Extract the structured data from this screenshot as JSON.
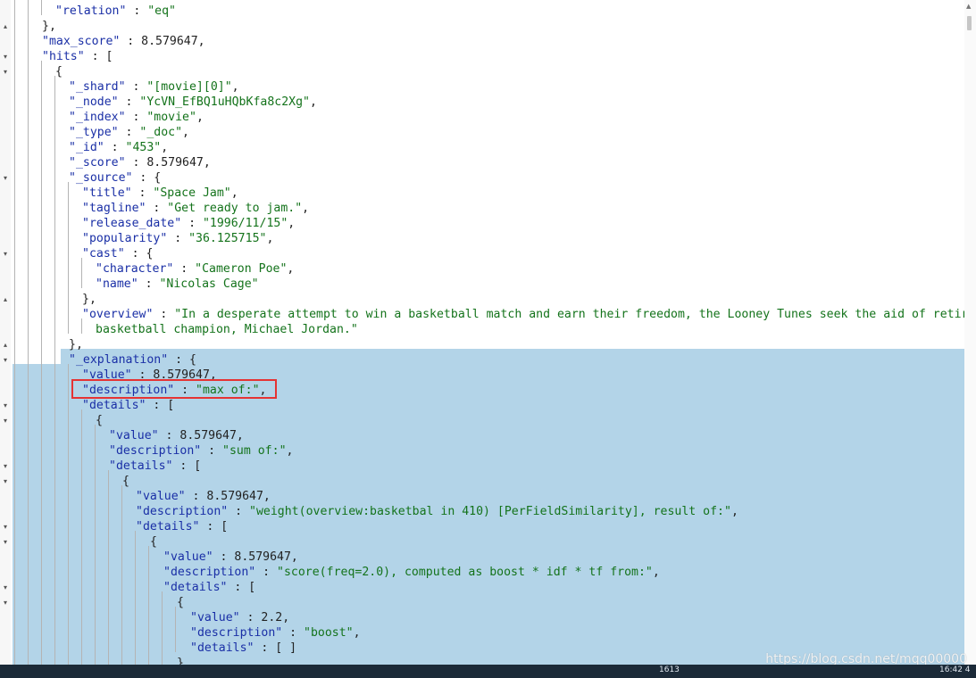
{
  "editor": {
    "lines": [
      {
        "key": "\"relation\"",
        "sep": " : ",
        "str": "\"eq\"",
        "end": ""
      },
      {
        "key": "",
        "sep": "",
        "str": "",
        "end": "},"
      },
      {
        "key": "\"max_score\"",
        "sep": " : 8.579647,",
        "str": "",
        "end": ""
      },
      {
        "key": "\"hits\"",
        "sep": " : [",
        "str": "",
        "end": ""
      },
      {
        "key": "",
        "sep": "",
        "str": "",
        "end": "{"
      },
      {
        "key": "\"_shard\"",
        "sep": " : ",
        "str": "\"[movie][0]\"",
        "end": ","
      },
      {
        "key": "\"_node\"",
        "sep": " : ",
        "str": "\"YcVN_EfBQ1uHQbKfa8c2Xg\"",
        "end": ","
      },
      {
        "key": "\"_index\"",
        "sep": " : ",
        "str": "\"movie\"",
        "end": ","
      },
      {
        "key": "\"_type\"",
        "sep": " : ",
        "str": "\"_doc\"",
        "end": ","
      },
      {
        "key": "\"_id\"",
        "sep": " : ",
        "str": "\"453\"",
        "end": ","
      },
      {
        "key": "\"_score\"",
        "sep": " : 8.579647,",
        "str": "",
        "end": ""
      },
      {
        "key": "\"_source\"",
        "sep": " : {",
        "str": "",
        "end": ""
      },
      {
        "key": "\"title\"",
        "sep": " : ",
        "str": "\"Space Jam\"",
        "end": ","
      },
      {
        "key": "\"tagline\"",
        "sep": " : ",
        "str": "\"Get ready to jam.\"",
        "end": ","
      },
      {
        "key": "\"release_date\"",
        "sep": " : ",
        "str": "\"1996/11/15\"",
        "end": ","
      },
      {
        "key": "\"popularity\"",
        "sep": " : ",
        "str": "\"36.125715\"",
        "end": ","
      },
      {
        "key": "\"cast\"",
        "sep": " : {",
        "str": "",
        "end": ""
      },
      {
        "key": "\"character\"",
        "sep": " : ",
        "str": "\"Cameron Poe\"",
        "end": ","
      },
      {
        "key": "\"name\"",
        "sep": " : ",
        "str": "\"Nicolas Cage\"",
        "end": ""
      },
      {
        "key": "",
        "sep": "",
        "str": "",
        "end": "},"
      },
      {
        "key": "\"overview\"",
        "sep": " : ",
        "str": "\"In a desperate attempt to win a basketball match and earn their freedom, the Looney Tunes seek the aid of retired",
        "end": ""
      },
      {
        "key": "",
        "sep": "",
        "str": "basketball champion, Michael Jordan.\"",
        "end": ""
      },
      {
        "key": "",
        "sep": "",
        "str": "",
        "end": "},"
      },
      {
        "key": "\"_explanation\"",
        "sep": " : {",
        "str": "",
        "end": ""
      },
      {
        "key": "\"value\"",
        "sep": " : 8.579647,",
        "str": "",
        "end": ""
      },
      {
        "key": "\"description\"",
        "sep": " : ",
        "str": "\"max of:\"",
        "end": ","
      },
      {
        "key": "\"details\"",
        "sep": " : [",
        "str": "",
        "end": ""
      },
      {
        "key": "",
        "sep": "",
        "str": "",
        "end": "{"
      },
      {
        "key": "\"value\"",
        "sep": " : 8.579647,",
        "str": "",
        "end": ""
      },
      {
        "key": "\"description\"",
        "sep": " : ",
        "str": "\"sum of:\"",
        "end": ","
      },
      {
        "key": "\"details\"",
        "sep": " : [",
        "str": "",
        "end": ""
      },
      {
        "key": "",
        "sep": "",
        "str": "",
        "end": "{"
      },
      {
        "key": "\"value\"",
        "sep": " : 8.579647,",
        "str": "",
        "end": ""
      },
      {
        "key": "\"description\"",
        "sep": " : ",
        "str": "\"weight(overview:basketbal in 410) [PerFieldSimilarity], result of:\"",
        "end": ","
      },
      {
        "key": "\"details\"",
        "sep": " : [",
        "str": "",
        "end": ""
      },
      {
        "key": "",
        "sep": "",
        "str": "",
        "end": "{"
      },
      {
        "key": "\"value\"",
        "sep": " : 8.579647,",
        "str": "",
        "end": ""
      },
      {
        "key": "\"description\"",
        "sep": " : ",
        "str": "\"score(freq=2.0), computed as boost * idf * tf from:\"",
        "end": ","
      },
      {
        "key": "\"details\"",
        "sep": " : [",
        "str": "",
        "end": ""
      },
      {
        "key": "",
        "sep": "",
        "str": "",
        "end": "{"
      },
      {
        "key": "\"value\"",
        "sep": " : 2.2,",
        "str": "",
        "end": ""
      },
      {
        "key": "\"description\"",
        "sep": " : ",
        "str": "\"boost\"",
        "end": ","
      },
      {
        "key": "\"details\"",
        "sep": " : [ ]",
        "str": "",
        "end": ""
      },
      {
        "key": "",
        "sep": "",
        "str": "",
        "end": "}"
      }
    ]
  },
  "watermark": "https://blog.csdn.net/mqq00000",
  "taskbar": {
    "left_text": "1613",
    "right_text": "16:42 4"
  },
  "colors": {
    "selection": "#b3d4e8",
    "highlight_box": "#e53333",
    "key": "#1a2fa6",
    "string": "#14731b"
  }
}
